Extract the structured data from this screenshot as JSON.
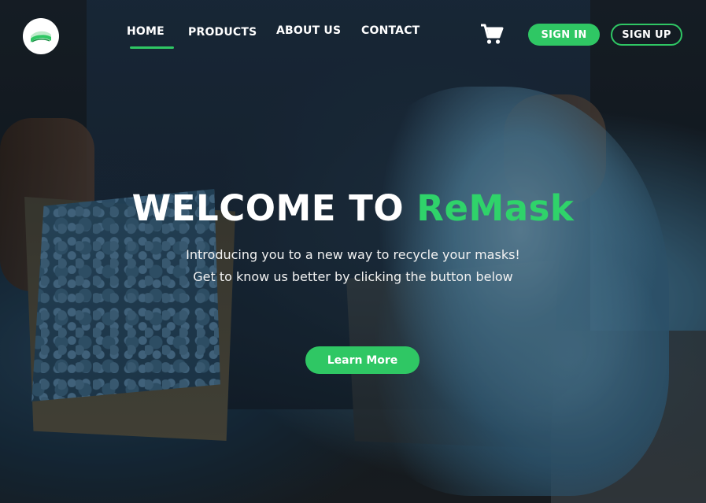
{
  "nav": {
    "links": [
      {
        "label": "HOME",
        "active": true
      },
      {
        "label": "PRODUCTS",
        "active": false
      },
      {
        "label": "ABOUT US",
        "active": false
      },
      {
        "label": "CONTACT",
        "active": false
      }
    ],
    "cart_icon": "shopping-cart-icon",
    "sign_in_label": "SIGN IN",
    "sign_up_label": "SIGN UP"
  },
  "hero": {
    "title_prefix": "WELCOME TO ",
    "title_brand": "ReMask",
    "subtitle_line1": "Introducing you to a new way to recycle your masks!",
    "subtitle_line2": "Get to know us better by clicking the button below",
    "cta_label": "Learn More"
  },
  "colors": {
    "accent": "#2fc764",
    "brand_text": "#2fd36a",
    "text": "#ffffff"
  }
}
